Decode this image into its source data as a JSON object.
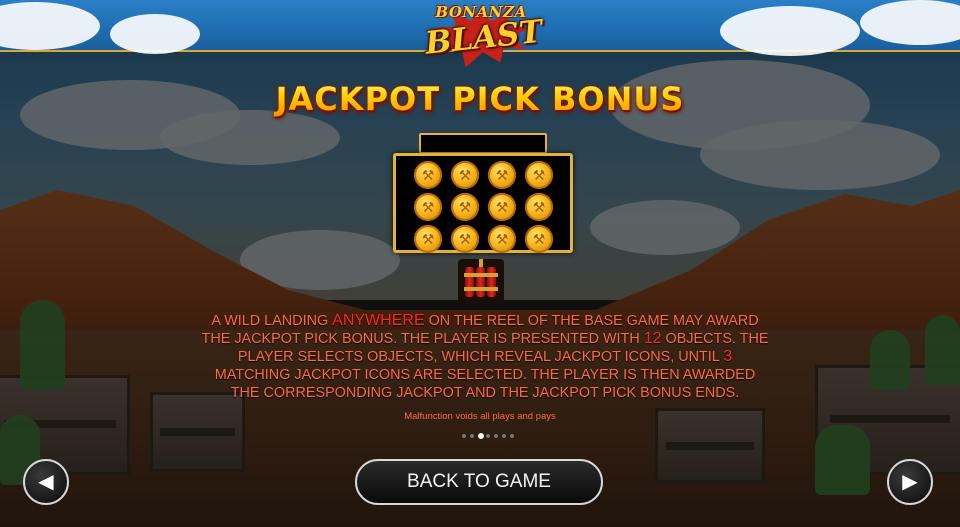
{
  "header": {
    "logo_top": "BONANZA",
    "logo_main": "BLAST"
  },
  "title": "JACKPOT PICK BONUS",
  "board": {
    "objects": [
      "",
      "",
      "",
      "",
      "",
      "",
      "",
      "",
      "",
      "",
      "",
      ""
    ],
    "icon": "pickaxe-coin-icon"
  },
  "dynamite_icon": "dynamite-icon",
  "description": {
    "p1": "A wild landing ",
    "h1": "ANYWHERE",
    "p2": " on the reel of the base game may award the jackpot pick bonus. The player is presented with ",
    "h2": "12",
    "p3": " objects. The player selects objects, which reveal jackpot icons, until ",
    "h3": "3",
    "p4": " matching jackpot icons are selected. The player is then awarded the corresponding jackpot and the jackpot pick bonus ends."
  },
  "disclaimer": "Malfunction voids all plays and pays",
  "pagination": {
    "total": 7,
    "active_index": 2
  },
  "buttons": {
    "back_to_game": "BACK TO GAME",
    "prev_icon": "arrow-left-icon",
    "next_icon": "arrow-right-icon"
  },
  "colors": {
    "accent_gold": "#e2b23b",
    "description_text": "#ff6a4a",
    "highlight_text": "#ff2a1a",
    "title_gold": "#ffcc00"
  }
}
